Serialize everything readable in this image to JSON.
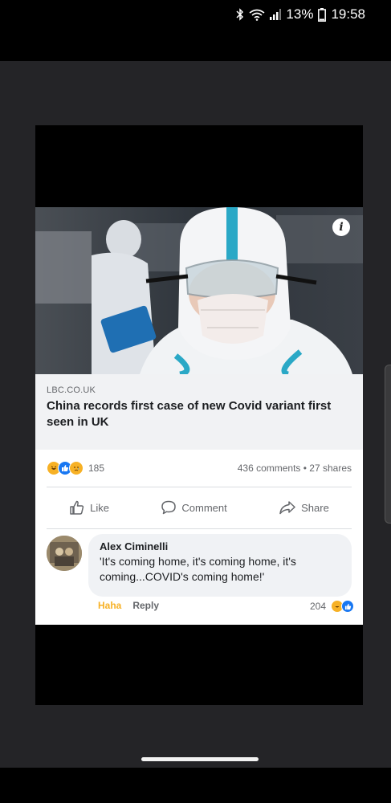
{
  "status_bar": {
    "battery": "13%",
    "time": "19:58"
  },
  "post": {
    "source": "LBC.CO.UK",
    "headline": "China records first case of new Covid variant first seen in UK",
    "reaction_count": "185",
    "stats_text": "436 comments • 27 shares",
    "actions": {
      "like": "Like",
      "comment": "Comment",
      "share": "Share"
    }
  },
  "comment": {
    "author": "Alex Ciminelli",
    "text": "'It's coming home, it's coming home, it's coming...COVID's coming home!'",
    "reaction_label": "Haha",
    "reply_label": "Reply",
    "reaction_count": "204"
  },
  "colors": {
    "facebook_blue": "#1877f2",
    "haha_yellow": "#f7b125",
    "meta_grey": "#65676b"
  }
}
